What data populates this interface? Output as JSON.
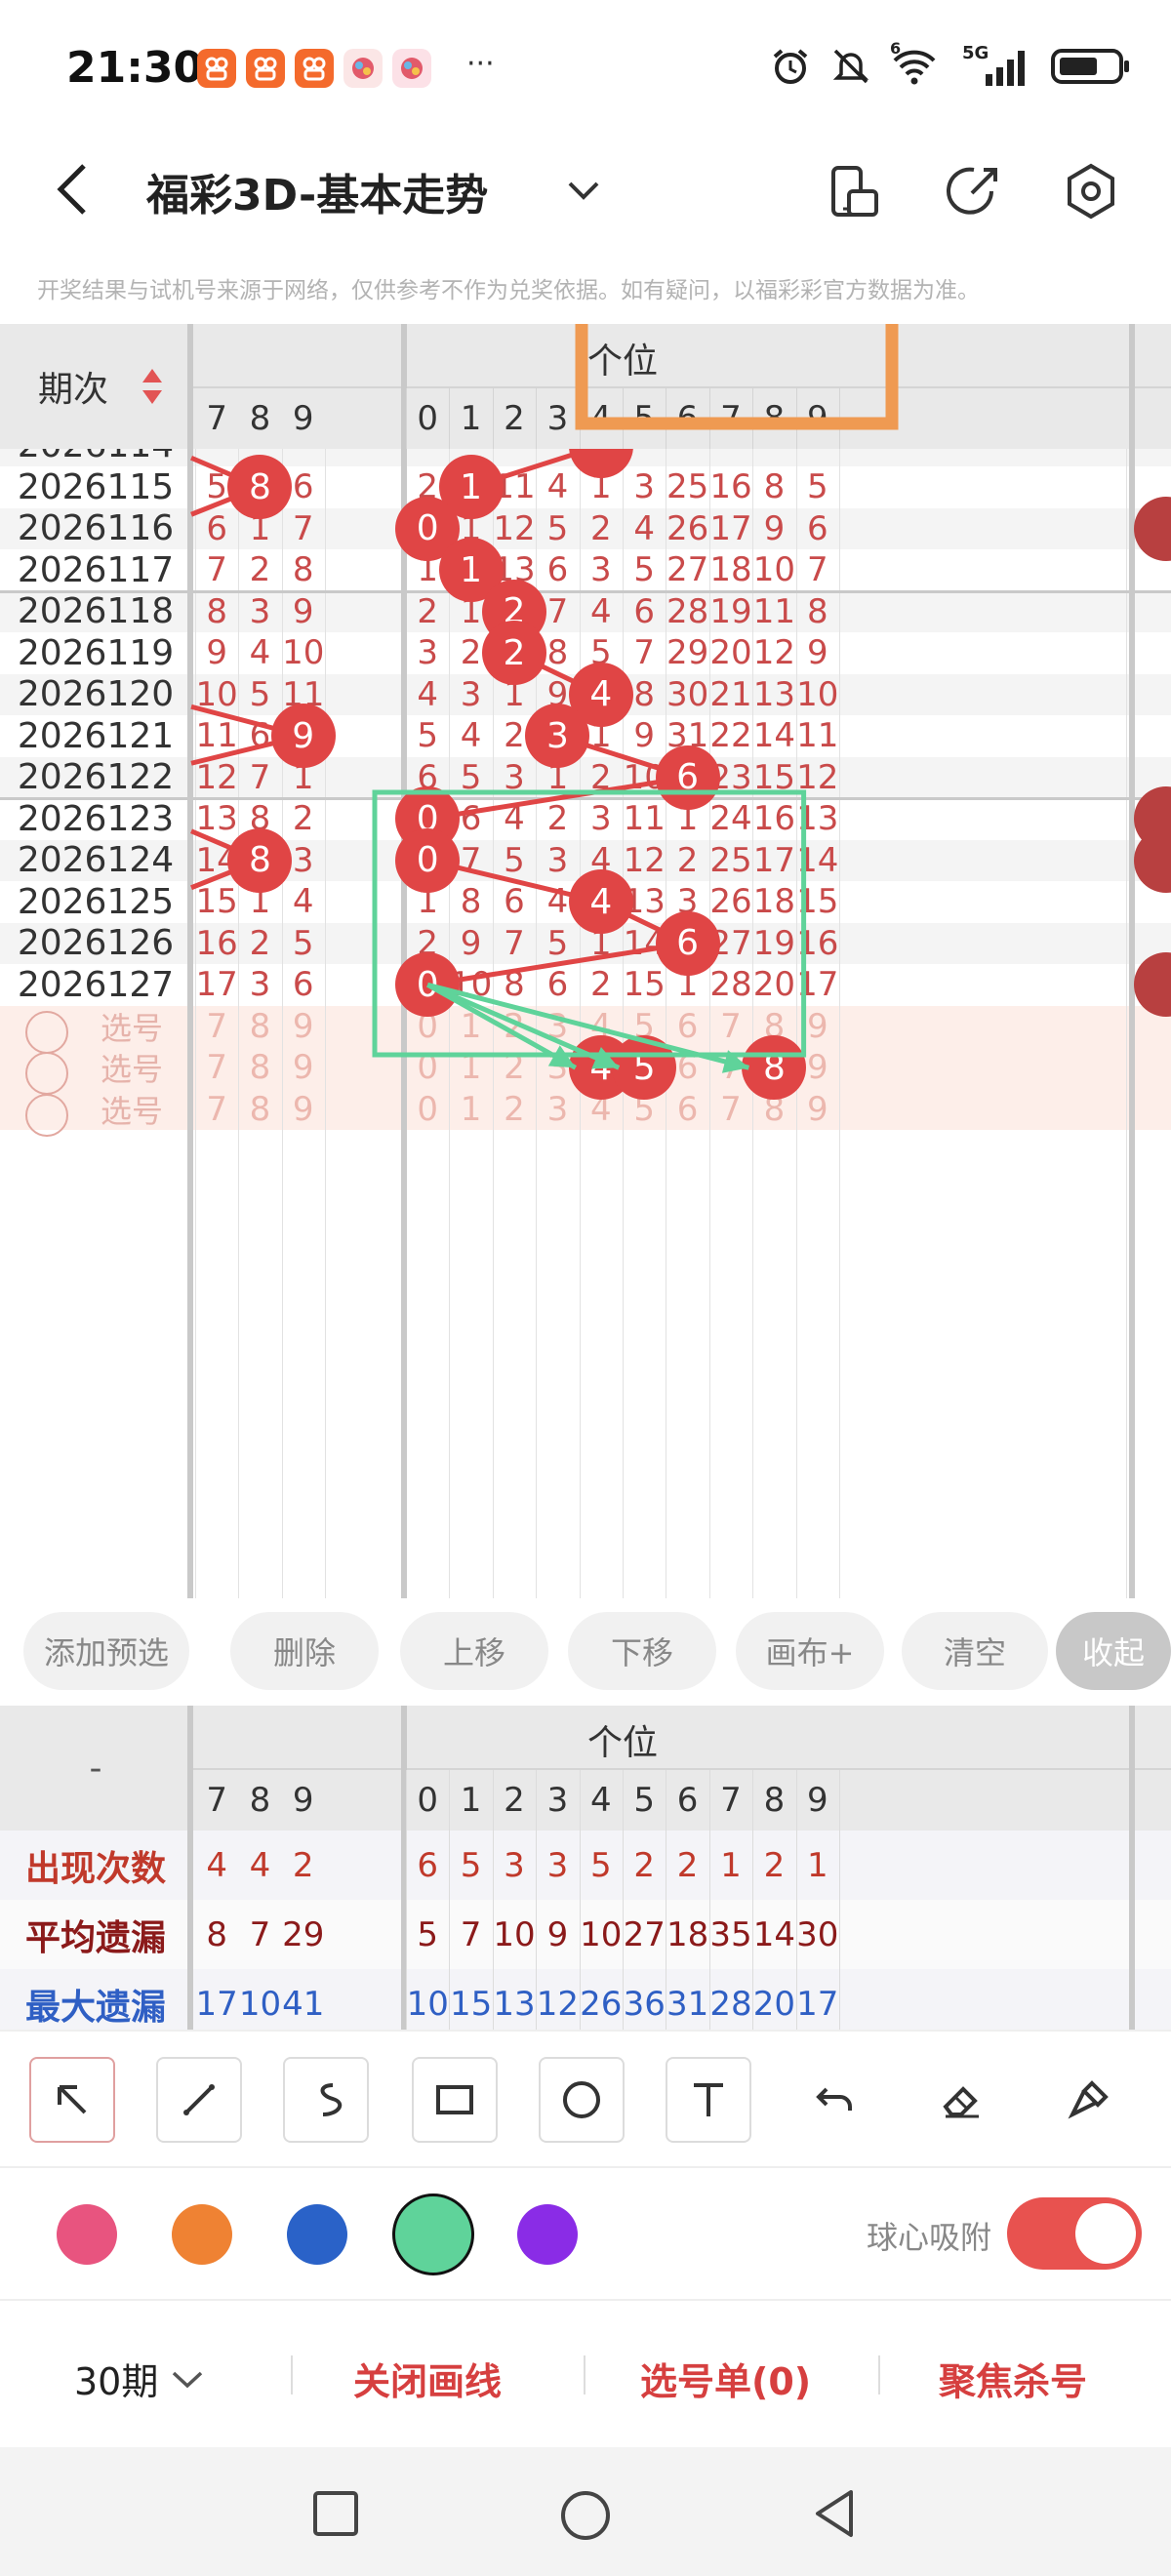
{
  "status_bar": {
    "time": "21:30",
    "overflow": "···",
    "signal_label": "5G",
    "wifi_label": "6",
    "app_icons": [
      "kuaishou-icon",
      "kuaishou-icon",
      "kuaishou-icon",
      "promo-app-icon",
      "candy-app-icon"
    ],
    "right_icons": [
      "alarm-icon",
      "mute-icon",
      "wifi-icon",
      "signal-icon",
      "battery-icon"
    ]
  },
  "nav": {
    "title": "福彩3D-基本走势",
    "right_icons": [
      "phone-rotate-icon",
      "share-icon",
      "settings-icon"
    ]
  },
  "disclaimer": "开奖结果与试机号来源于网络，仅供参考不作为兑奖依据。如有疑问，以福彩彩官方数据为准。",
  "table": {
    "period_header": "期次",
    "section_header": "个位",
    "left_digits": [
      "7",
      "8",
      "9"
    ],
    "digits": [
      "0",
      "1",
      "2",
      "3",
      "4",
      "5",
      "6",
      "7",
      "8",
      "9"
    ],
    "rows": [
      {
        "period": "2026115",
        "left": [
          "5",
          "8",
          "6"
        ],
        "vals": [
          "2",
          "1",
          "11",
          "4",
          "1",
          "3",
          "25",
          "16",
          "8",
          "5"
        ]
      },
      {
        "period": "2026116",
        "left": [
          "6",
          "1",
          "7"
        ],
        "vals": [
          "0",
          "1",
          "12",
          "5",
          "2",
          "4",
          "26",
          "17",
          "9",
          "6"
        ]
      },
      {
        "period": "2026117",
        "left": [
          "7",
          "2",
          "8"
        ],
        "vals": [
          "1",
          "1",
          "13",
          "6",
          "3",
          "5",
          "27",
          "18",
          "10",
          "7"
        ]
      },
      {
        "period": "2026118",
        "left": [
          "8",
          "3",
          "9"
        ],
        "vals": [
          "2",
          "1",
          "2",
          "7",
          "4",
          "6",
          "28",
          "19",
          "11",
          "8"
        ]
      },
      {
        "period": "2026119",
        "left": [
          "9",
          "4",
          "10"
        ],
        "vals": [
          "3",
          "2",
          "2",
          "8",
          "5",
          "7",
          "29",
          "20",
          "12",
          "9"
        ]
      },
      {
        "period": "2026120",
        "left": [
          "10",
          "5",
          "11"
        ],
        "vals": [
          "4",
          "3",
          "1",
          "9",
          "4",
          "8",
          "30",
          "21",
          "13",
          "10"
        ]
      },
      {
        "period": "2026121",
        "left": [
          "11",
          "6",
          "9"
        ],
        "vals": [
          "5",
          "4",
          "2",
          "3",
          "1",
          "9",
          "31",
          "22",
          "14",
          "11"
        ]
      },
      {
        "period": "2026122",
        "left": [
          "12",
          "7",
          "1"
        ],
        "vals": [
          "6",
          "5",
          "3",
          "1",
          "2",
          "10",
          "6",
          "23",
          "15",
          "12"
        ]
      },
      {
        "period": "2026123",
        "left": [
          "13",
          "8",
          "2"
        ],
        "vals": [
          "0",
          "6",
          "4",
          "2",
          "3",
          "11",
          "1",
          "24",
          "16",
          "13"
        ]
      },
      {
        "period": "2026124",
        "left": [
          "14",
          "8",
          "3"
        ],
        "vals": [
          "0",
          "7",
          "5",
          "3",
          "4",
          "12",
          "2",
          "25",
          "17",
          "14"
        ]
      },
      {
        "period": "2026125",
        "left": [
          "15",
          "1",
          "4"
        ],
        "vals": [
          "1",
          "8",
          "6",
          "4",
          "4",
          "13",
          "3",
          "26",
          "18",
          "15"
        ]
      },
      {
        "period": "2026126",
        "left": [
          "16",
          "2",
          "5"
        ],
        "vals": [
          "2",
          "9",
          "7",
          "5",
          "1",
          "14",
          "6",
          "27",
          "19",
          "16"
        ]
      },
      {
        "period": "2026127",
        "left": [
          "17",
          "3",
          "6"
        ],
        "vals": [
          "0",
          "10",
          "8",
          "6",
          "2",
          "15",
          "1",
          "28",
          "20",
          "17"
        ]
      }
    ],
    "hits": [
      1,
      0,
      1,
      2,
      2,
      4,
      3,
      6,
      0,
      0,
      4,
      6,
      0
    ],
    "left_hits": [
      1,
      null,
      null,
      null,
      null,
      null,
      2,
      null,
      null,
      1,
      null,
      null,
      null
    ],
    "select_label": "选号",
    "select_rows": [
      {
        "selected": []
      },
      {
        "selected": [
          4,
          5,
          8
        ]
      },
      {
        "selected": []
      }
    ]
  },
  "toolbar_buttons": [
    "添加预选",
    "删除",
    "上移",
    "下移",
    "画布+",
    "清空",
    "收起"
  ],
  "stats": {
    "corner": "-",
    "section_header": "个位",
    "rows": [
      {
        "label": "出现次数",
        "left": [
          "4",
          "4",
          "2"
        ],
        "vals": [
          "6",
          "5",
          "3",
          "3",
          "5",
          "2",
          "2",
          "1",
          "2",
          "1"
        ],
        "color": "#c0392b"
      },
      {
        "label": "平均遗漏",
        "left": [
          "8",
          "7",
          "29"
        ],
        "vals": [
          "5",
          "7",
          "10",
          "9",
          "10",
          "27",
          "18",
          "35",
          "14",
          "30"
        ],
        "color": "#8b1a1a"
      },
      {
        "label": "最大遗漏",
        "left": [
          "17",
          "10",
          "41"
        ],
        "vals": [
          "10",
          "15",
          "13",
          "12",
          "26",
          "36",
          "31",
          "28",
          "20",
          "17"
        ],
        "color": "#2f5fc4"
      }
    ]
  },
  "draw_tools": [
    {
      "name": "select-arrow-tool",
      "icon": "arrow-up-left-icon",
      "active": true
    },
    {
      "name": "line-tool",
      "icon": "line-icon",
      "active": false
    },
    {
      "name": "curve-tool",
      "icon": "curve-icon",
      "active": false
    },
    {
      "name": "rectangle-tool",
      "icon": "rectangle-icon",
      "active": false
    },
    {
      "name": "circle-tool",
      "icon": "circle-icon",
      "active": false
    },
    {
      "name": "text-tool",
      "icon": "text-icon",
      "active": false
    },
    {
      "name": "undo-tool",
      "icon": "undo-icon",
      "active": false
    },
    {
      "name": "eraser-tool",
      "icon": "eraser-icon",
      "active": false
    },
    {
      "name": "brush-tool",
      "icon": "brush-icon",
      "active": false
    }
  ],
  "colors": {
    "palette": [
      "#e8547f",
      "#ef8233",
      "#2a62c8",
      "#5fd39a",
      "#8a2ce6"
    ],
    "selected_color": "#5fd39a",
    "accent": "#e25454",
    "ball": "#e04545",
    "number_red": "#c94a4a",
    "green_overlay": "#5fd39a",
    "orange_overlay": "#ef9a52"
  },
  "snap": {
    "label": "球心吸附",
    "enabled": true
  },
  "bottom_bar": {
    "period_select": "30期",
    "close_lines": "关闭画线",
    "selection_list": "选号单(0)",
    "focus_kill": "聚焦杀号"
  },
  "system_nav": [
    "recents-square-icon",
    "home-circle-icon",
    "back-triangle-icon"
  ]
}
